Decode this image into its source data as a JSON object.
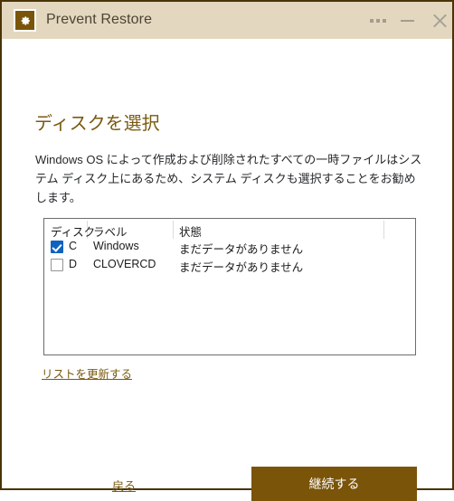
{
  "window": {
    "border_color": "#4a3408",
    "titlebar": {
      "background": "#e3d8bf",
      "app_icon": "gear-icon",
      "title": "Prevent Restore",
      "buttons": {
        "more": "•••",
        "minimize": "—",
        "close": "✕"
      }
    }
  },
  "page": {
    "heading": "ディスクを選択",
    "description": "Windows OS によって作成および削除されたすべての一時ファイルはシステム ディスク上にあるため、システム ディスクも選択することをお勧めします。",
    "heading_color": "#7a5a10"
  },
  "disk_table": {
    "columns": [
      "ディスク",
      "ラベル",
      "状態"
    ],
    "rows": [
      {
        "checked": true,
        "disk": "C",
        "label": "Windows",
        "state": "まだデータがありません"
      },
      {
        "checked": false,
        "disk": "D",
        "label": "CLOVERCD",
        "state": "まだデータがありません"
      }
    ],
    "checkbox_checked_color": "#0f62c0"
  },
  "links": {
    "refresh": "リストを更新する",
    "back": "戻る",
    "link_color": "#7a5a10"
  },
  "footer": {
    "continue_label": "継続する",
    "continue_color": "#7a5409"
  }
}
